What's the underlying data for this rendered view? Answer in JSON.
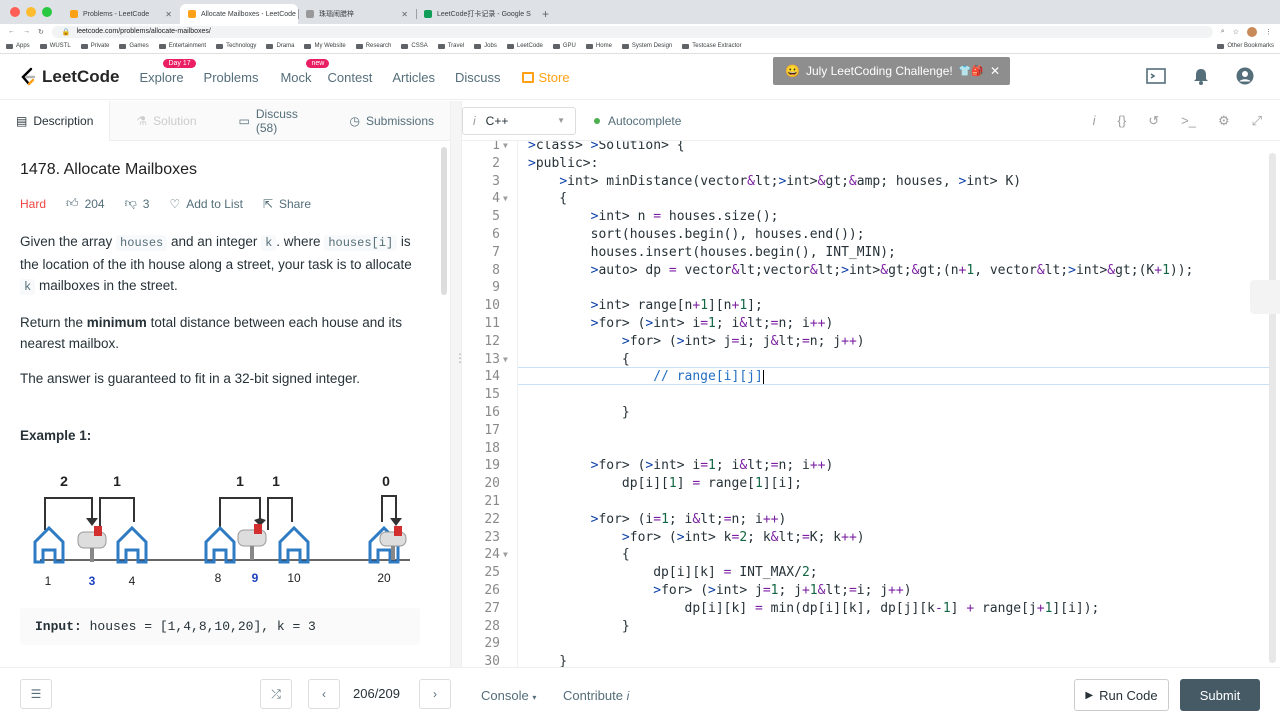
{
  "browser": {
    "tabs": [
      {
        "title": "Problems - LeetCode",
        "active": false
      },
      {
        "title": "Allocate Mailboxes - LeetCode",
        "active": true
      },
      {
        "title": "珠瑙闹腊梓",
        "active": false
      },
      {
        "title": "LeetCode打卡记录 - Google S",
        "active": false
      }
    ],
    "url": "leetcode.com/problems/allocate-mailboxes/",
    "bookmarks": [
      "Apps",
      "WUSTL",
      "Private",
      "Games",
      "Entertainment",
      "Technology",
      "Drama",
      "My Website",
      "Research",
      "CSSA",
      "Travel",
      "Jobs",
      "LeetCode",
      "GPU",
      "Home",
      "System Design",
      "Testcase Extractor"
    ],
    "other_bookmarks": "Other Bookmarks"
  },
  "nav": {
    "logo": "LeetCode",
    "explore": "Explore",
    "explore_badge": "Day 17",
    "problems": "Problems",
    "mock": "Mock",
    "mock_badge": "new",
    "contest": "Contest",
    "articles": "Articles",
    "discuss": "Discuss",
    "store": "Store",
    "challenge": "July LeetCoding Challenge!"
  },
  "left_tabs": {
    "description": "Description",
    "solution": "Solution",
    "discuss": "Discuss (58)",
    "submissions": "Submissions"
  },
  "problem": {
    "title": "1478. Allocate Mailboxes",
    "difficulty": "Hard",
    "likes": "204",
    "dislikes": "3",
    "add_to_list": "Add to List",
    "share": "Share",
    "p1_a": "Given the array ",
    "p1_code1": "houses",
    "p1_b": " and an integer ",
    "p1_code2": "k",
    "p1_c": ". where ",
    "p1_code3": "houses[i]",
    "p1_d": " is the location of the ith house along a street, your task is to allocate ",
    "p1_code4": "k",
    "p1_e": " mailboxes in the street.",
    "p2_a": "Return the ",
    "p2_bold": "minimum",
    "p2_b": " total distance between each house and its nearest mailbox.",
    "p3": "The answer is guaranteed to fit in a 32-bit signed integer.",
    "example_title": "Example 1:",
    "diagram": {
      "distances": [
        "2",
        "1",
        "1",
        "1",
        "0"
      ],
      "positions": [
        "1",
        "3",
        "4",
        "8",
        "9",
        "10",
        "20"
      ]
    },
    "input_label": "Input:",
    "input_value": " houses = [1,4,8,10,20], k = 3"
  },
  "editor": {
    "language": "C++",
    "autocomplete": "Autocomplete",
    "lines": [
      {
        "n": "1",
        "fold": true,
        "code": "class Solution {"
      },
      {
        "n": "2",
        "fold": false,
        "code": "public:"
      },
      {
        "n": "3",
        "fold": false,
        "code": "    int minDistance(vector<int>& houses, int K)"
      },
      {
        "n": "4",
        "fold": true,
        "code": "    {"
      },
      {
        "n": "5",
        "fold": false,
        "code": "        int n = houses.size();"
      },
      {
        "n": "6",
        "fold": false,
        "code": "        sort(houses.begin(), houses.end());"
      },
      {
        "n": "7",
        "fold": false,
        "code": "        houses.insert(houses.begin(), INT_MIN);"
      },
      {
        "n": "8",
        "fold": false,
        "code": "        auto dp = vector<vector<int>>(n+1, vector<int>(K+1));"
      },
      {
        "n": "9",
        "fold": false,
        "code": ""
      },
      {
        "n": "10",
        "fold": false,
        "code": "        int range[n+1][n+1];"
      },
      {
        "n": "11",
        "fold": false,
        "code": "        for (int i=1; i<=n; i++)"
      },
      {
        "n": "12",
        "fold": false,
        "code": "            for (int j=i; j<=n; j++)"
      },
      {
        "n": "13",
        "fold": true,
        "code": "            {"
      },
      {
        "n": "14",
        "fold": false,
        "code": "                // range[i][j]"
      },
      {
        "n": "15",
        "fold": false,
        "code": ""
      },
      {
        "n": "16",
        "fold": false,
        "code": "            }"
      },
      {
        "n": "17",
        "fold": false,
        "code": ""
      },
      {
        "n": "18",
        "fold": false,
        "code": ""
      },
      {
        "n": "19",
        "fold": false,
        "code": "        for (int i=1; i<=n; i++)"
      },
      {
        "n": "20",
        "fold": false,
        "code": "            dp[i][1] = range[1][i];"
      },
      {
        "n": "21",
        "fold": false,
        "code": ""
      },
      {
        "n": "22",
        "fold": false,
        "code": "        for (i=1; i<=n; i++)"
      },
      {
        "n": "23",
        "fold": false,
        "code": "            for (int k=2; k<=K; k++)"
      },
      {
        "n": "24",
        "fold": true,
        "code": "            {"
      },
      {
        "n": "25",
        "fold": false,
        "code": "                dp[i][k] = INT_MAX/2;"
      },
      {
        "n": "26",
        "fold": false,
        "code": "                for (int j=1; j+1<=i; j++)"
      },
      {
        "n": "27",
        "fold": false,
        "code": "                    dp[i][k] = min(dp[i][k], dp[j][k-1] + range[j+1][i]);"
      },
      {
        "n": "28",
        "fold": false,
        "code": "            }"
      },
      {
        "n": "29",
        "fold": false,
        "code": ""
      },
      {
        "n": "30",
        "fold": false,
        "code": "    }"
      }
    ]
  },
  "footer": {
    "page": "206/209",
    "console": "Console",
    "contribute": "Contribute",
    "run": "Run Code",
    "submit": "Submit"
  },
  "colors": {
    "brand": "#ffa116",
    "hard": "#ef4743",
    "keyword": "#0b3fa8",
    "submit_bg": "#455a64"
  }
}
